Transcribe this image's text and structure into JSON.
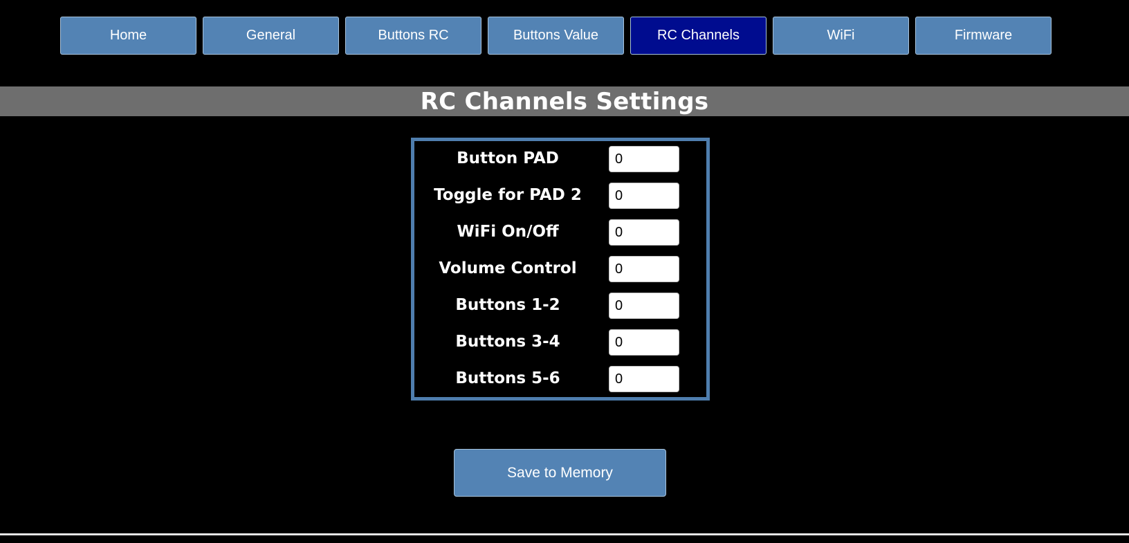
{
  "nav": {
    "tabs": [
      {
        "label": "Home",
        "active": false
      },
      {
        "label": "General",
        "active": false
      },
      {
        "label": "Buttons RC",
        "active": false
      },
      {
        "label": "Buttons Value",
        "active": false
      },
      {
        "label": "RC Channels",
        "active": true
      },
      {
        "label": "WiFi",
        "active": false
      },
      {
        "label": "Firmware",
        "active": false
      }
    ]
  },
  "page": {
    "title": "RC Channels Settings"
  },
  "settings": {
    "rows": [
      {
        "label": "Button PAD",
        "value": "0"
      },
      {
        "label": "Toggle for PAD 2",
        "value": "0"
      },
      {
        "label": "WiFi On/Off",
        "value": "0"
      },
      {
        "label": "Volume Control",
        "value": "0"
      },
      {
        "label": "Buttons 1-2",
        "value": "0"
      },
      {
        "label": "Buttons 3-4",
        "value": "0"
      },
      {
        "label": "Buttons 5-6",
        "value": "0"
      }
    ]
  },
  "actions": {
    "save_label": "Save to Memory"
  },
  "colors": {
    "background": "#000000",
    "button": "#5383b4",
    "active_tab": "#000c8f",
    "title_bar": "#6e6e6e",
    "box_border": "#4f7eae"
  }
}
